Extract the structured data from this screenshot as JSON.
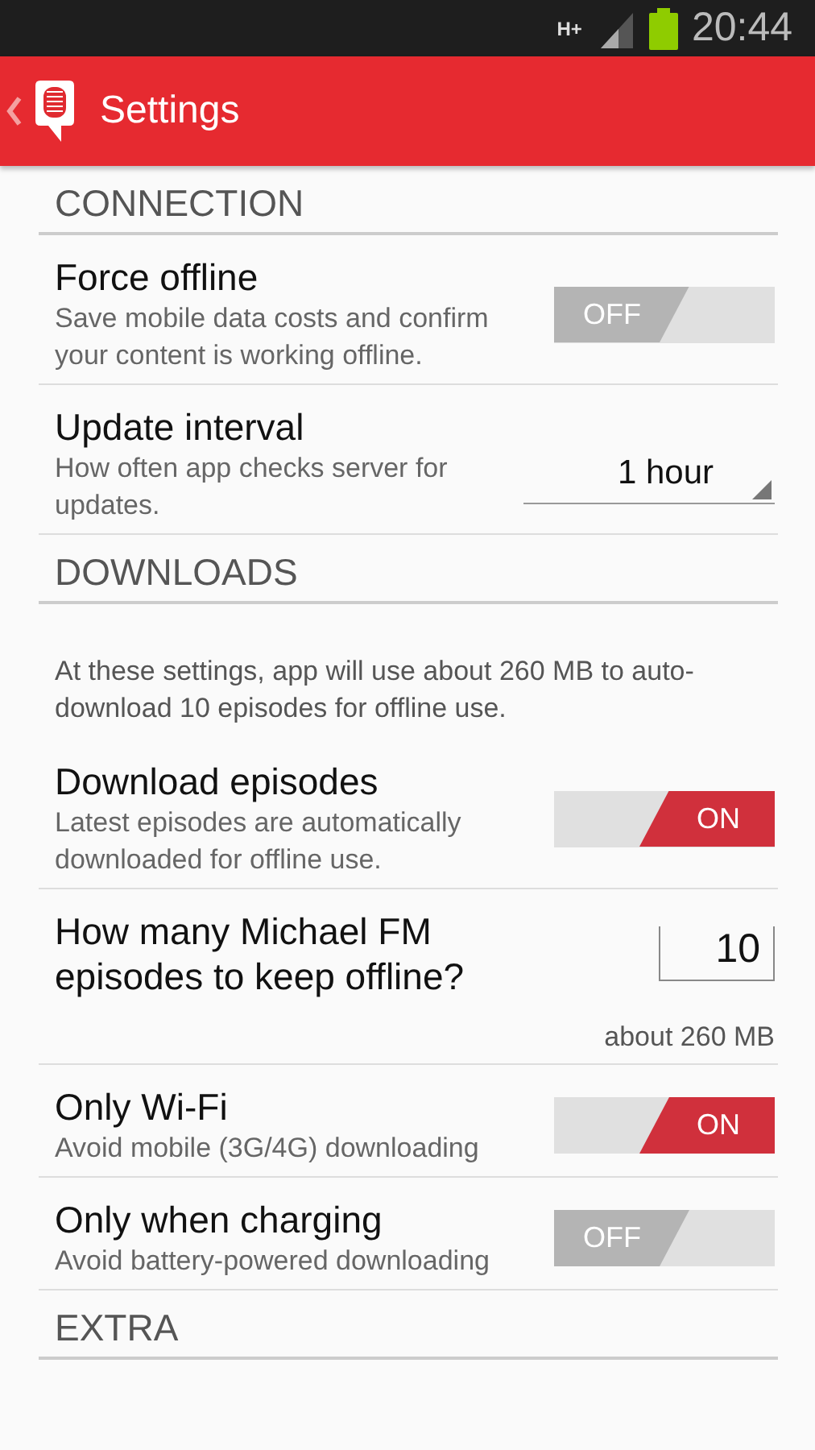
{
  "status_bar": {
    "network": "H+",
    "time": "20:44"
  },
  "action_bar": {
    "title": "Settings"
  },
  "items": [
    {
      "kind": "header",
      "title": "CONNECTION"
    },
    {
      "kind": "toggle",
      "title": "Force offline",
      "summary": "Save mobile data costs and confirm your content is working offline.",
      "on": false,
      "label": "OFF"
    },
    {
      "kind": "dropdown",
      "title": "Update interval",
      "summary": "How often app checks server for updates.",
      "value": "1 hour"
    },
    {
      "kind": "header",
      "title": "DOWNLOADS"
    },
    {
      "kind": "note",
      "text": "At these settings, app will use about 260 MB to auto-download 10 episodes for offline use."
    },
    {
      "kind": "toggle",
      "title": "Download episodes",
      "summary": "Latest episodes are automatically downloaded for offline use.",
      "on": true,
      "label": "ON"
    },
    {
      "kind": "number",
      "title": "How many Michael FM episodes to keep offline?",
      "value": "10",
      "caption": "about 260 MB"
    },
    {
      "kind": "toggle",
      "title": "Only Wi-Fi",
      "summary": "Avoid mobile (3G/4G) downloading",
      "on": true,
      "label": "ON"
    },
    {
      "kind": "toggle",
      "title": "Only when charging",
      "summary": "Avoid battery-powered downloading",
      "on": false,
      "label": "OFF"
    },
    {
      "kind": "header",
      "title": "EXTRA"
    }
  ]
}
